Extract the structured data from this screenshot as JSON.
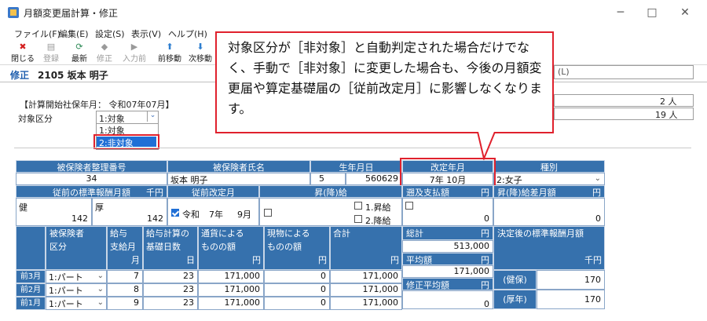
{
  "window": {
    "title": "月額変更届計算・修正",
    "minimize": "─",
    "maximize": "□",
    "close": "✕"
  },
  "menu": [
    "ファイル(F)",
    "編集(E)",
    "設定(S)",
    "表示(V)",
    "ヘルプ(H)"
  ],
  "toolbar": [
    {
      "label": "閉じる",
      "icon": "close-red-icon",
      "glyph": "✖",
      "enabled": true
    },
    {
      "label": "登録",
      "icon": "register-icon",
      "glyph": "▤",
      "enabled": false
    },
    {
      "label": "最新",
      "icon": "refresh-icon",
      "glyph": "⟳",
      "enabled": true
    },
    {
      "label": "修正",
      "icon": "edit-icon",
      "glyph": "◆",
      "enabled": false
    },
    {
      "label": "入力前",
      "icon": "before-input-icon",
      "glyph": "▶",
      "enabled": false
    },
    {
      "label": "前移動",
      "icon": "prev-icon",
      "glyph": "⬆",
      "enabled": true
    },
    {
      "label": "次移動",
      "icon": "next-icon",
      "glyph": "⬇",
      "enabled": true
    }
  ],
  "mode_label": "修正",
  "employee": "2105 坂本 明子",
  "right_hint": "(L)",
  "calc_start": "【計算開始社保年月： 令和07年07月】",
  "target_label": "対象区分",
  "target_value": "1:対象",
  "dropdown_options": [
    "1:対象",
    "2:非対象"
  ],
  "count_1": "2 人",
  "count_2": "19 人",
  "callout": "対象区分が［非対象］と自動判定された場合だけでなく、手動で［非対象］に変更した場合も、今後の月額変更届や算定基礎届の［従前改定月］に影響しなくなります。",
  "table": {
    "h_insured_no": "被保険者整理番号",
    "h_name": "被保険者氏名",
    "h_birth": "生年月日",
    "h_revision": "改定年月",
    "h_type": "種別",
    "insured_no": "34",
    "name": "坂本 明子",
    "birth_era": "5",
    "birth": "560629",
    "revision": "7年 10月",
    "type": "2:女子",
    "h_prev_amount": "従前の標準報酬月額",
    "h_unit_thousand": "千円",
    "h_prev_rev": "従前改定月",
    "h_updown": "昇(降)給",
    "h_retro": "遡及支払額",
    "h_yen": "円",
    "h_diff": "昇(降)給差月額",
    "kenko_label": "健",
    "kousei_label": "厚",
    "prev_kenko": "142",
    "prev_kousei": "142",
    "prev_rev_era": "令和",
    "prev_rev_year": "7年",
    "prev_rev_month": "9月",
    "up_label": "1.昇給",
    "down_label": "2.降給",
    "retro_value": "0",
    "diff_value": "0",
    "h_cat": "被保険者",
    "h_cat2": "区分",
    "h_pay": "給与",
    "h_pay2": "支給月",
    "h_pay3": "月",
    "h_days": "給与計算の",
    "h_days2": "基礎日数",
    "h_days3": "日",
    "h_cash": "通貨による",
    "h_cash2": "ものの額",
    "h_kind": "現物による",
    "h_kind2": "ものの額",
    "h_total": "合計",
    "h_sum": "総計",
    "h_avg": "平均額",
    "h_adjavg": "修正平均額",
    "h_after": "決定後の標準報酬月額",
    "rows": [
      {
        "label": "前3月",
        "cat": "1:パート",
        "month": "7",
        "days": "23",
        "cash": "171,000",
        "kind": "0",
        "total": "171,000"
      },
      {
        "label": "前2月",
        "cat": "1:パート",
        "month": "8",
        "days": "23",
        "cash": "171,000",
        "kind": "0",
        "total": "171,000"
      },
      {
        "label": "前1月",
        "cat": "1:パート",
        "month": "9",
        "days": "23",
        "cash": "171,000",
        "kind": "0",
        "total": "171,000"
      }
    ],
    "sum_value": "513,000",
    "avg_value": "171,000",
    "adj_value": "0",
    "after_kenko_label": "(健保)",
    "after_kousei_label": "(厚年)",
    "after_kenko": "170",
    "after_kousei": "170"
  },
  "colors": {
    "header": "#3671ad",
    "accent_red": "#e0212d",
    "mode_blue": "#1f5fae"
  }
}
